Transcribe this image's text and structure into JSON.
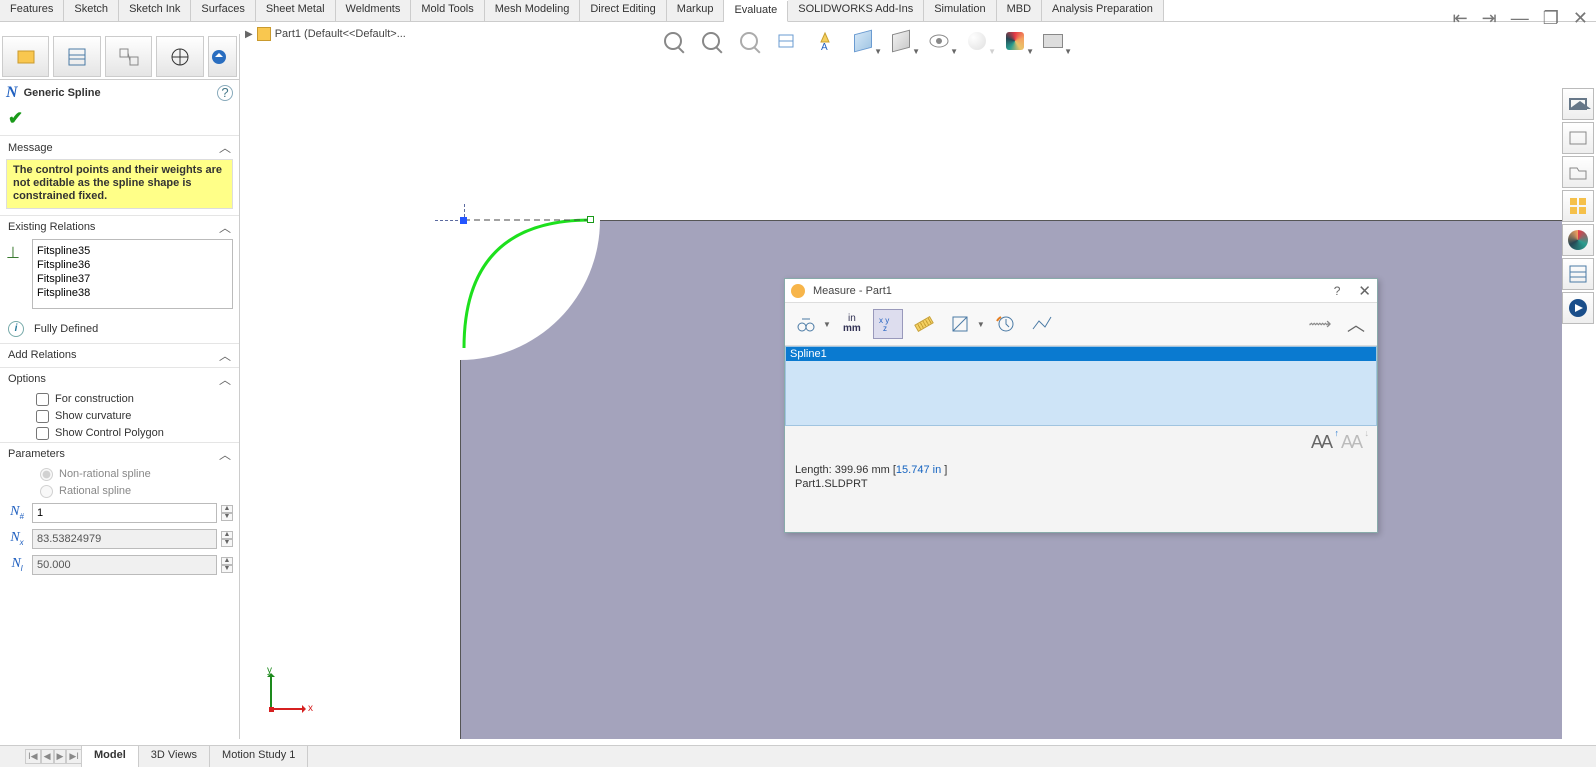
{
  "ribbon": {
    "tabs": [
      "Features",
      "Sketch",
      "Sketch Ink",
      "Surfaces",
      "Sheet Metal",
      "Weldments",
      "Mold Tools",
      "Mesh Modeling",
      "Direct Editing",
      "Markup",
      "Evaluate",
      "SOLIDWORKS Add-Ins",
      "Simulation",
      "MBD",
      "Analysis Preparation"
    ],
    "active": "Evaluate"
  },
  "breadcrumb": {
    "part": "Part1  (Default<<Default>..."
  },
  "property_manager": {
    "title": "Generic Spline",
    "message_header": "Message",
    "message": "The control points and their weights are not editable as the spline shape is constrained fixed.",
    "existing_header": "Existing Relations",
    "relations": [
      "Fitspline35",
      "Fitspline36",
      "Fitspline37",
      "Fitspline38"
    ],
    "status": "Fully Defined",
    "add_header": "Add Relations",
    "options_header": "Options",
    "options": {
      "construction": "For construction",
      "curvature": "Show curvature",
      "polygon": "Show Control Polygon"
    },
    "parameters_header": "Parameters",
    "param_radio": {
      "nonrational": "Non-rational spline",
      "rational": "Rational spline"
    },
    "params": {
      "n": "1",
      "k": "83.53824979",
      "w": "50.000"
    }
  },
  "triad": {
    "x": "x",
    "y": "y"
  },
  "measure": {
    "title": "Measure - Part1",
    "units": {
      "top": "in",
      "bottom": "mm"
    },
    "selection": "Spline1",
    "length_label": "Length: ",
    "length_mm": "399.96 mm  ",
    "length_in_open": "[",
    "length_in": "15.747 in ",
    "length_in_close": "]",
    "file": "Part1.SLDPRT"
  },
  "bottom": {
    "tabs": [
      "Model",
      "3D Views",
      "Motion Study 1"
    ],
    "active": "Model"
  }
}
